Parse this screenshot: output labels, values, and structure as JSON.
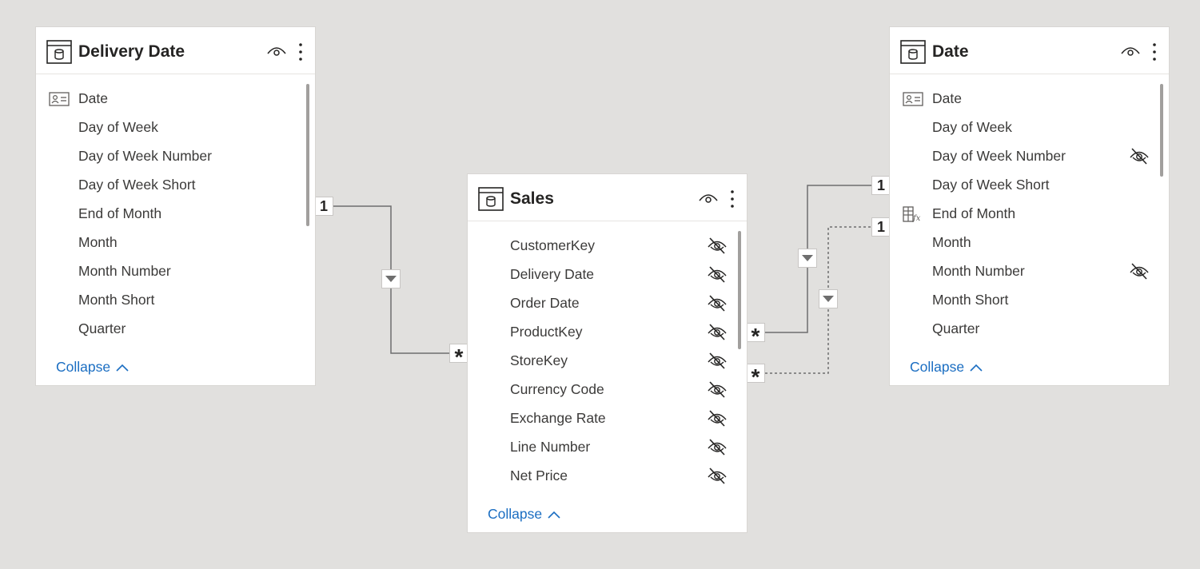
{
  "tables": {
    "delivery_date": {
      "title": "Delivery Date",
      "fields": [
        {
          "name": "Date",
          "icon": "key-field-icon",
          "hidden": false
        },
        {
          "name": "Day of Week",
          "icon": "",
          "hidden": false
        },
        {
          "name": "Day of Week Number",
          "icon": "",
          "hidden": false
        },
        {
          "name": "Day of Week Short",
          "icon": "",
          "hidden": false
        },
        {
          "name": "End of Month",
          "icon": "",
          "hidden": false
        },
        {
          "name": "Month",
          "icon": "",
          "hidden": false
        },
        {
          "name": "Month Number",
          "icon": "",
          "hidden": false
        },
        {
          "name": "Month Short",
          "icon": "",
          "hidden": false
        },
        {
          "name": "Quarter",
          "icon": "",
          "hidden": false
        }
      ],
      "collapse_label": "Collapse"
    },
    "sales": {
      "title": "Sales",
      "fields": [
        {
          "name": "CustomerKey",
          "icon": "",
          "hidden": true
        },
        {
          "name": "Delivery Date",
          "icon": "",
          "hidden": true
        },
        {
          "name": "Order Date",
          "icon": "",
          "hidden": true
        },
        {
          "name": "ProductKey",
          "icon": "",
          "hidden": true
        },
        {
          "name": "StoreKey",
          "icon": "",
          "hidden": true
        },
        {
          "name": "Currency Code",
          "icon": "",
          "hidden": true
        },
        {
          "name": "Exchange Rate",
          "icon": "",
          "hidden": true
        },
        {
          "name": "Line Number",
          "icon": "",
          "hidden": true
        },
        {
          "name": "Net Price",
          "icon": "",
          "hidden": true
        }
      ],
      "collapse_label": "Collapse"
    },
    "date": {
      "title": "Date",
      "fields": [
        {
          "name": "Date",
          "icon": "key-field-icon",
          "hidden": false
        },
        {
          "name": "Day of Week",
          "icon": "",
          "hidden": false
        },
        {
          "name": "Day of Week Number",
          "icon": "",
          "hidden": true
        },
        {
          "name": "Day of Week Short",
          "icon": "",
          "hidden": false
        },
        {
          "name": "End of Month",
          "icon": "calculated-column-icon",
          "hidden": false
        },
        {
          "name": "Month",
          "icon": "",
          "hidden": false
        },
        {
          "name": "Month Number",
          "icon": "",
          "hidden": true
        },
        {
          "name": "Month Short",
          "icon": "",
          "hidden": false
        },
        {
          "name": "Quarter",
          "icon": "",
          "hidden": false
        }
      ],
      "collapse_label": "Collapse"
    }
  },
  "relationships": {
    "one_label": "1",
    "many_label": "*"
  },
  "colors": {
    "canvas": "#e1e0de",
    "link": "#1b6ec2",
    "line": "#6e6e6e"
  }
}
